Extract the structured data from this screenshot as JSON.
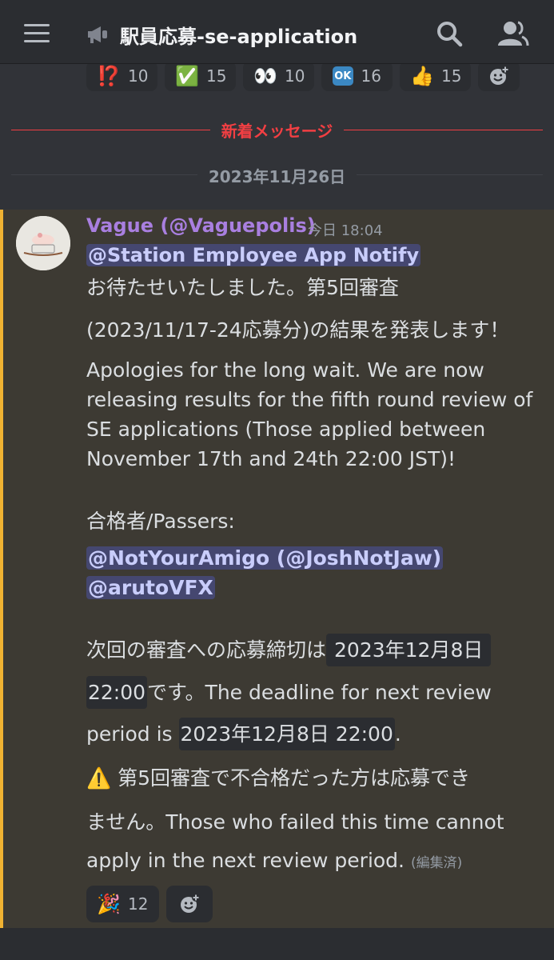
{
  "header": {
    "channel_name": "駅員応募-se-application",
    "menu_icon": "hamburger-icon",
    "channel_icon": "megaphone-icon",
    "search_icon": "search-icon",
    "members_icon": "members-icon"
  },
  "top_reactions": [
    {
      "emoji": "⁉️",
      "count": "10"
    },
    {
      "emoji": "✅",
      "count": "15"
    },
    {
      "emoji": "👀",
      "count": "10"
    },
    {
      "emoji": "OK",
      "count": "16"
    },
    {
      "emoji": "👍",
      "count": "15"
    }
  ],
  "dividers": {
    "new_messages": "新着メッセージ",
    "date": "2023年11月26日"
  },
  "message": {
    "author": "Vague (@Vaguepolis)",
    "timestamp": "今日 18:04",
    "role_mention": "@Station Employee App Notify",
    "jp_line1": "お待たせいたしました。第5回審査",
    "jp_line2": "(2023/11/17-24応募分)の結果を発表します！",
    "en_lines": [
      "Apologies for the long wait. We are now",
      "releasing results for the fifth round review of",
      "SE applications (Those applied between",
      "November 17th and 24th 22:00 JST)!"
    ],
    "passers_label": "合格者/Passers:",
    "passers": [
      "@NotYourAmigo (@JoshNotJaw)",
      "@arutoVFX"
    ],
    "deadline_prefix": "次回の審査への応募締切は",
    "deadline_code1": "2023年12月8日",
    "deadline_code2": "22:00",
    "deadline_mid": "です。The deadline for next review",
    "deadline_line3_prefix": "period is ",
    "deadline_code3": "2023年12月8日 22:00",
    "deadline_line3_suffix": ".",
    "warning_emoji": "⚠️",
    "warning_jp1": "第5回審査で不合格だった方は応募でき",
    "warning_line2": "ません。Those who failed this time cannot",
    "warning_line3": "apply in the next review period.",
    "edited": "(編集済)",
    "reaction": {
      "emoji": "🎉",
      "count": "12"
    }
  },
  "colors": {
    "background": "#313338",
    "highlight": "#3d3a33",
    "highlight_bar": "#f0b232",
    "author": "#a97fe0",
    "new_messages": "#f23f43",
    "mention_bg": "#5865f2"
  }
}
